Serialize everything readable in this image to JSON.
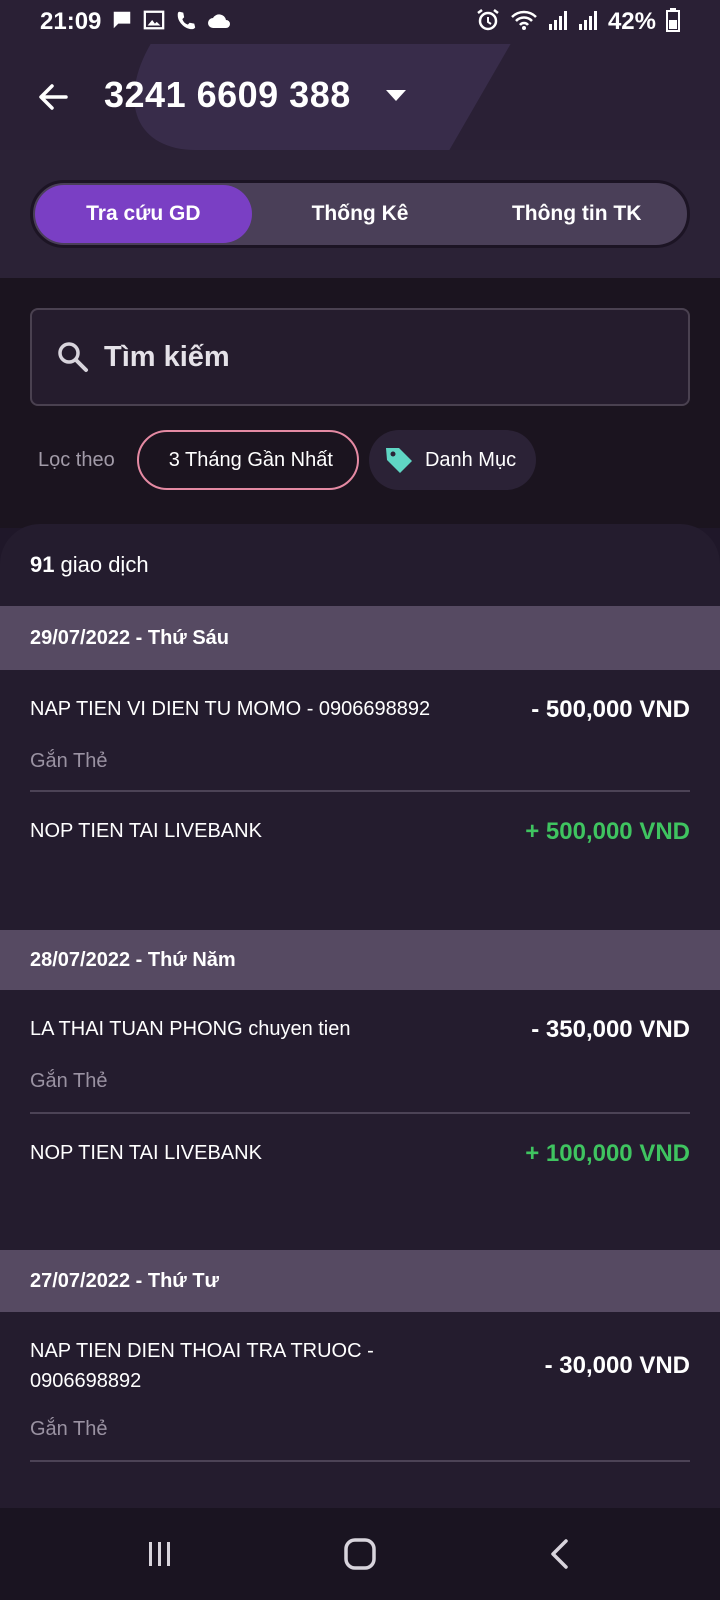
{
  "status_bar": {
    "time": "21:09",
    "battery": "42%"
  },
  "header": {
    "account_number": "3241 6609 388"
  },
  "tabs": [
    {
      "label": "Tra cứu GD",
      "active": true
    },
    {
      "label": "Thống Kê",
      "active": false
    },
    {
      "label": "Thông tin TK",
      "active": false
    }
  ],
  "search": {
    "placeholder": "Tìm kiếm"
  },
  "filters": {
    "label": "Lọc theo",
    "period": "3 Tháng Gần Nhất",
    "category": "Danh Mục"
  },
  "summary": {
    "count": "91",
    "count_label": "giao dịch"
  },
  "groups": [
    {
      "date": "29/07/2022 - Thứ Sáu",
      "transactions": [
        {
          "description": "NAP TIEN VI DIEN TU MOMO - 0906698892",
          "amount": "- 500,000 VND",
          "type": "debit",
          "tag": "Gắn Thẻ"
        },
        {
          "description": "NOP TIEN TAI LIVEBANK",
          "amount": "+ 500,000 VND",
          "type": "credit",
          "tag": ""
        }
      ]
    },
    {
      "date": "28/07/2022 - Thứ Năm",
      "transactions": [
        {
          "description": "LA THAI TUAN PHONG chuyen tien",
          "amount": "- 350,000 VND",
          "type": "debit",
          "tag": "Gắn Thẻ"
        },
        {
          "description": "NOP TIEN TAI LIVEBANK",
          "amount": "+ 100,000 VND",
          "type": "credit",
          "tag": ""
        }
      ]
    },
    {
      "date": "27/07/2022 - Thứ Tư",
      "transactions": [
        {
          "description": "NAP TIEN DIEN THOAI TRA TRUOC - 0906698892",
          "amount": "- 30,000 VND",
          "type": "debit",
          "tag": "Gắn Thẻ"
        }
      ]
    }
  ],
  "colors": {
    "accent": "#7a3fc4",
    "credit": "#3fc460",
    "chip_border": "#e58aa3",
    "tag_icon": "#5fd6c4"
  }
}
